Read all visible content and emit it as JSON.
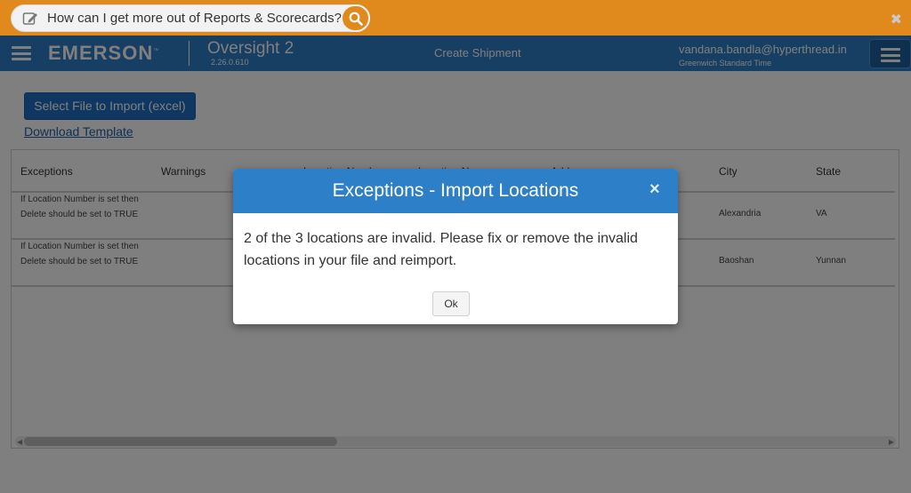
{
  "helpbar": {
    "question": "How can I get more out of Reports & Scorecards?",
    "close_label": "✖",
    "icons": [
      "edit-icon",
      "search-icon",
      "close-icon"
    ]
  },
  "header": {
    "brand": "EMERSON",
    "brand_tm": "™",
    "app_name": "Oversight 2",
    "version": "2.26.0.610",
    "page_title": "Create Shipment",
    "user_email": "vandana.bandla@hyperthread.in",
    "timezone": "Greenwich Standard Time",
    "colors": {
      "bar": "#2d7fc7",
      "helpbar": "#e08a1e"
    }
  },
  "toolbar": {
    "import_label": "Select File to Import (excel)",
    "download_label": "Download Template"
  },
  "grid": {
    "columns": [
      "Exceptions",
      "Warnings",
      "Location Number",
      "Location Name",
      "Address",
      "City",
      "State"
    ],
    "rows": [
      {
        "exception": "If Location Number is set then Delete should be set to TRUE",
        "city": "Alexandria",
        "state": "VA"
      },
      {
        "exception": "If Location Number is set then Delete should be set to TRUE",
        "city": "Baoshan",
        "state": "Yunnan"
      }
    ]
  },
  "modal": {
    "title": "Exceptions - Import Locations",
    "close_label": "×",
    "message": "2 of the 3 locations are invalid. Please fix or remove the invalid locations in your file and reimport.",
    "ok_label": "Ok"
  }
}
